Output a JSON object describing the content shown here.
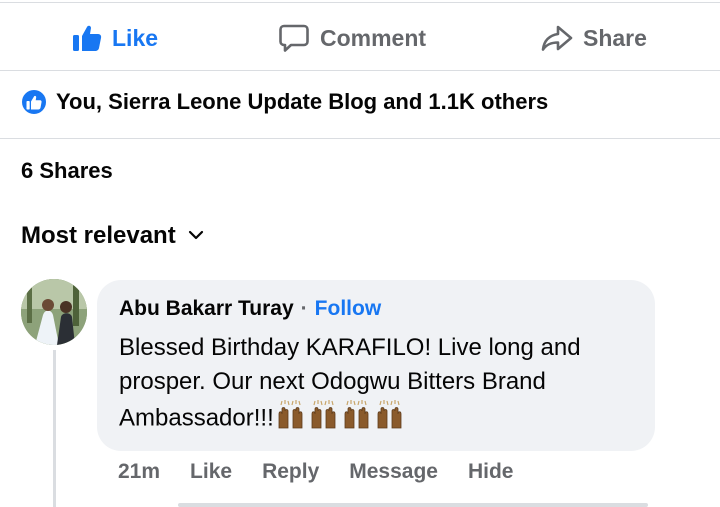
{
  "actions": {
    "like_label": "Like",
    "comment_label": "Comment",
    "share_label": "Share"
  },
  "reactions": {
    "icon": "thumbs-up-icon",
    "summary": "You, Sierra Leone Update Blog and 1.1K others"
  },
  "shares": {
    "label": "6 Shares"
  },
  "sort": {
    "label": "Most relevant",
    "icon": "chevron-down-icon"
  },
  "comment": {
    "author": "Abu Bakarr Turay",
    "separator": "·",
    "follow_label": "Follow",
    "text": "Blessed Birthday KARAFILO! Live long and prosper. Our next Odogwu Bitters Brand Ambassador!!!",
    "emoji": "raising-hands-icon",
    "emoji_count": 4,
    "time": "21m",
    "like_label": "Like",
    "reply_label": "Reply",
    "message_label": "Message",
    "hide_label": "Hide"
  },
  "colors": {
    "accent": "#1877f2",
    "muted": "#65676b",
    "bubble": "#f0f2f5",
    "divider": "#dadde1"
  }
}
